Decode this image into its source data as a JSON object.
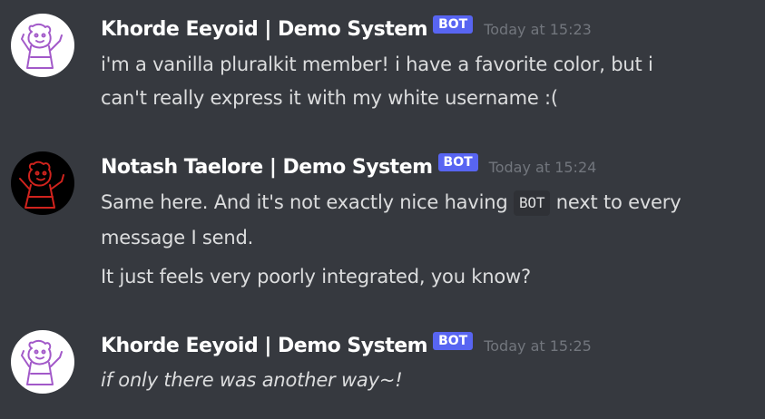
{
  "messages": [
    {
      "author": "Khorde Eeyoid | Demo System",
      "tag": "BOT",
      "timestamp": "Today at 15:23",
      "lines": [
        "i'm a vanilla pluralkit member! i have a favorite color, but i",
        "can't really express it with my white username :("
      ]
    },
    {
      "author": "Notash Taelore | Demo System",
      "tag": "BOT",
      "timestamp": "Today at 15:24",
      "line1_before": "Same here. And it's not exactly nice having",
      "line1_code": "BOT",
      "line1_after": "next to every",
      "line2": "message I send.",
      "line3": "It just feels very poorly integrated, you know?"
    },
    {
      "author": "Khorde Eeyoid | Demo System",
      "tag": "BOT",
      "timestamp": "Today at 15:25",
      "lines": [
        "if only there was another way~!"
      ]
    }
  ],
  "colors": {
    "background": "#36393f",
    "username": "#ffffff",
    "bot_tag": "#5865f2",
    "timestamp": "#72767d",
    "text": "#dcddde",
    "code_background": "#2f3136"
  },
  "icons": {
    "khorde_avatar": "doodle-avatar-purple",
    "notash_avatar": "doodle-avatar-red"
  }
}
